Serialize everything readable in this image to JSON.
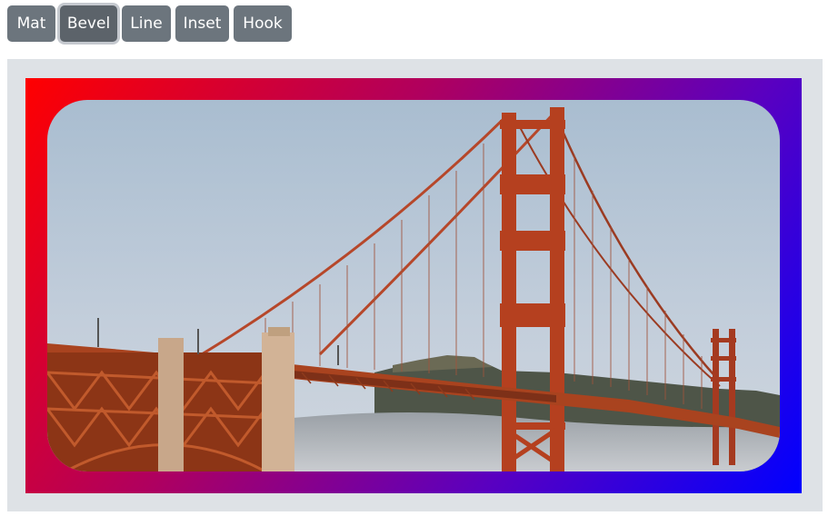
{
  "toolbar": {
    "buttons": [
      {
        "label": "Mat",
        "active": false
      },
      {
        "label": "Bevel",
        "active": true
      },
      {
        "label": "Line",
        "active": false
      },
      {
        "label": "Inset",
        "active": false
      },
      {
        "label": "Hook",
        "active": false
      }
    ]
  },
  "frame": {
    "gradient_start_color": "#ff0000",
    "gradient_end_color": "#0000ff",
    "background_color": "#dee2e6"
  },
  "photo": {
    "subject": "golden-gate-bridge-icon"
  }
}
